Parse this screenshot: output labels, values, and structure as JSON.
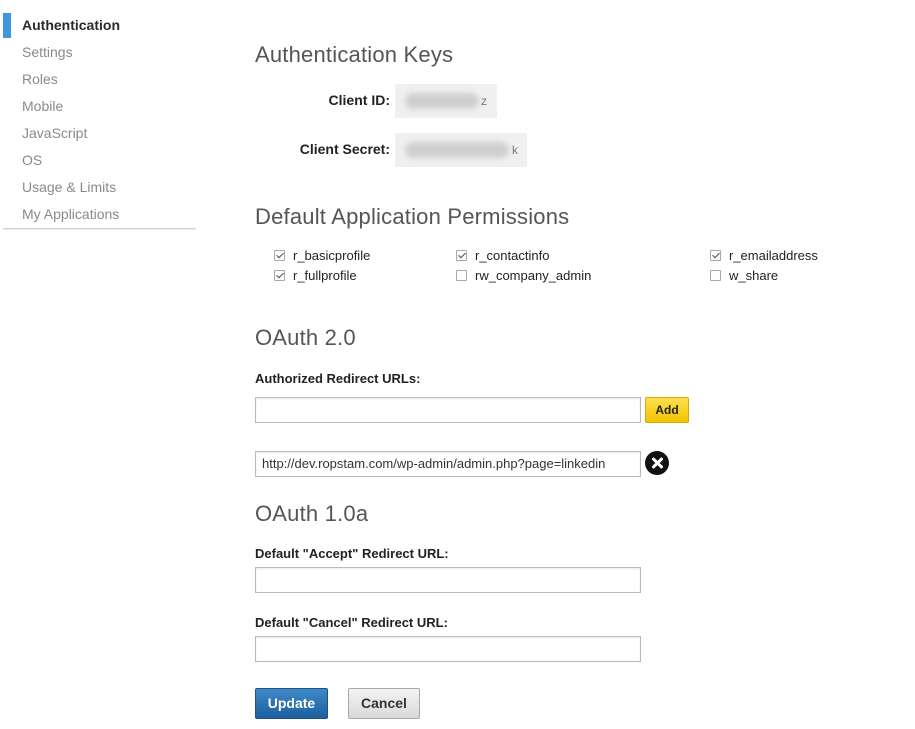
{
  "sidebar": {
    "items": [
      {
        "label": "Authentication",
        "active": true
      },
      {
        "label": "Settings"
      },
      {
        "label": "Roles"
      },
      {
        "label": "Mobile"
      },
      {
        "label": "JavaScript"
      },
      {
        "label": "OS"
      },
      {
        "label": "Usage & Limits"
      },
      {
        "label": "My Applications"
      }
    ]
  },
  "auth_keys": {
    "title": "Authentication Keys",
    "client_id_label": "Client ID:",
    "client_id_visible_tail": "z",
    "client_secret_label": "Client Secret:",
    "client_secret_visible_tail": "k"
  },
  "permissions": {
    "title": "Default Application Permissions",
    "items": [
      {
        "label": "r_basicprofile",
        "checked": true
      },
      {
        "label": "r_contactinfo",
        "checked": true
      },
      {
        "label": "r_emailaddress",
        "checked": true
      },
      {
        "label": "r_fullprofile",
        "checked": true
      },
      {
        "label": "rw_company_admin",
        "checked": false
      },
      {
        "label": "w_share",
        "checked": false
      }
    ]
  },
  "oauth2": {
    "title": "OAuth 2.0",
    "redirect_label": "Authorized Redirect URLs:",
    "new_url_value": "",
    "add_label": "Add",
    "urls": [
      "http://dev.ropstam.com/wp-admin/admin.php?page=linkedin"
    ]
  },
  "oauth1": {
    "title": "OAuth 1.0a",
    "accept_label": "Default \"Accept\" Redirect URL:",
    "accept_value": "",
    "cancel_label": "Default \"Cancel\" Redirect URL:",
    "cancel_value": ""
  },
  "actions": {
    "update_label": "Update",
    "cancel_label": "Cancel"
  },
  "colors": {
    "accent": "#3d97d8",
    "add_button": "#f3c300",
    "update_button": "#1d5f9e"
  }
}
